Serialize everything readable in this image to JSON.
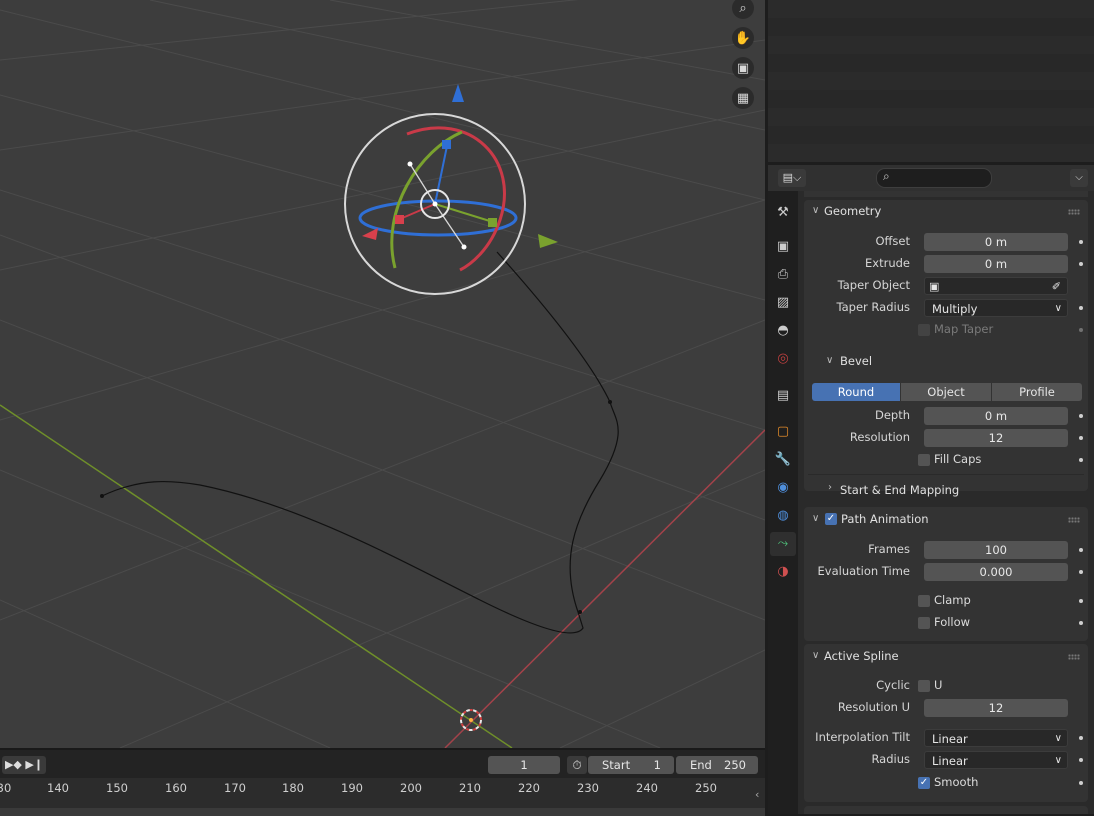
{
  "viewport": {
    "nav_icons": [
      "zoom-icon",
      "hand-icon",
      "camera-icon",
      "grid-icon"
    ]
  },
  "timeline": {
    "current_frame": "1",
    "start_label": "Start",
    "start_value": "1",
    "end_label": "End",
    "end_value": "250",
    "ruler_ticks": [
      "30",
      "140",
      "150",
      "160",
      "170",
      "180",
      "190",
      "200",
      "210",
      "220",
      "230",
      "240",
      "250"
    ]
  },
  "props_header": {
    "search_placeholder": ""
  },
  "props_tabs": [
    "tool-icon",
    "render-icon",
    "output-icon",
    "view-layer-icon",
    "scene-icon",
    "world-icon",
    "collection-icon",
    "object-icon",
    "modifier-icon",
    "particles-icon",
    "physics-icon",
    "curve-data-icon",
    "material-icon"
  ],
  "geometry": {
    "title": "Geometry",
    "offset_label": "Offset",
    "offset_value": "0 m",
    "extrude_label": "Extrude",
    "extrude_value": "0 m",
    "taper_object_label": "Taper Object",
    "taper_radius_label": "Taper Radius",
    "taper_radius_value": "Multiply",
    "map_taper_label": "Map Taper"
  },
  "bevel": {
    "title": "Bevel",
    "modes": [
      "Round",
      "Object",
      "Profile"
    ],
    "active_mode": "Round",
    "depth_label": "Depth",
    "depth_value": "0 m",
    "resolution_label": "Resolution",
    "resolution_value": "12",
    "fill_caps_label": "Fill Caps",
    "mapping_title": "Start & End Mapping"
  },
  "path_animation": {
    "title": "Path Animation",
    "frames_label": "Frames",
    "frames_value": "100",
    "eval_label": "Evaluation Time",
    "eval_value": "0.000",
    "clamp_label": "Clamp",
    "follow_label": "Follow"
  },
  "active_spline": {
    "title": "Active Spline",
    "cyclic_label": "Cyclic",
    "cyclic_u_label": "U",
    "resolution_u_label": "Resolution U",
    "resolution_u_value": "12",
    "interp_tilt_label": "Interpolation Tilt",
    "interp_tilt_value": "Linear",
    "radius_label": "Radius",
    "radius_value": "Linear",
    "smooth_label": "Smooth"
  },
  "colors": {
    "accent": "#4772b3",
    "x_axis": "#c94a55",
    "y_axis": "#7aa22e",
    "z_axis": "#2f6fd6"
  }
}
